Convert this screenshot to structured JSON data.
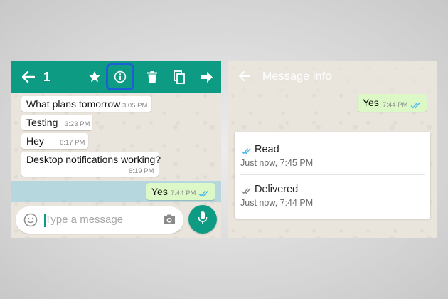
{
  "chat": {
    "selected_count": "1",
    "messages": [
      {
        "text": "What plans tomorrow",
        "time": "3:05 PM"
      },
      {
        "text": "Testing",
        "time": "3:23 PM"
      },
      {
        "text": "Hey",
        "time": "6:17 PM"
      },
      {
        "text": "Desktop notifications working?",
        "time": "6:19 PM"
      }
    ],
    "sent_message": {
      "text": "Yes",
      "time": "7:44 PM"
    },
    "input_placeholder": "Type a message"
  },
  "message_info": {
    "title": "Message info",
    "message": {
      "text": "Yes",
      "time": "7:44 PM"
    },
    "read": {
      "label": "Read",
      "time": "Just now, 7:45 PM"
    },
    "delivered": {
      "label": "Delivered",
      "time": "Just now, 7:44 PM"
    }
  },
  "colors": {
    "accent": "#0e9b84",
    "sent_bubble": "#dcf8c6",
    "read_ticks": "#4fb6ec",
    "highlight_border": "#1c5fd6"
  },
  "icons": [
    "back-arrow-icon",
    "star-icon",
    "info-icon",
    "delete-icon",
    "copy-icon",
    "forward-icon",
    "emoji-icon",
    "camera-icon",
    "mic-icon",
    "double-check-icon"
  ]
}
